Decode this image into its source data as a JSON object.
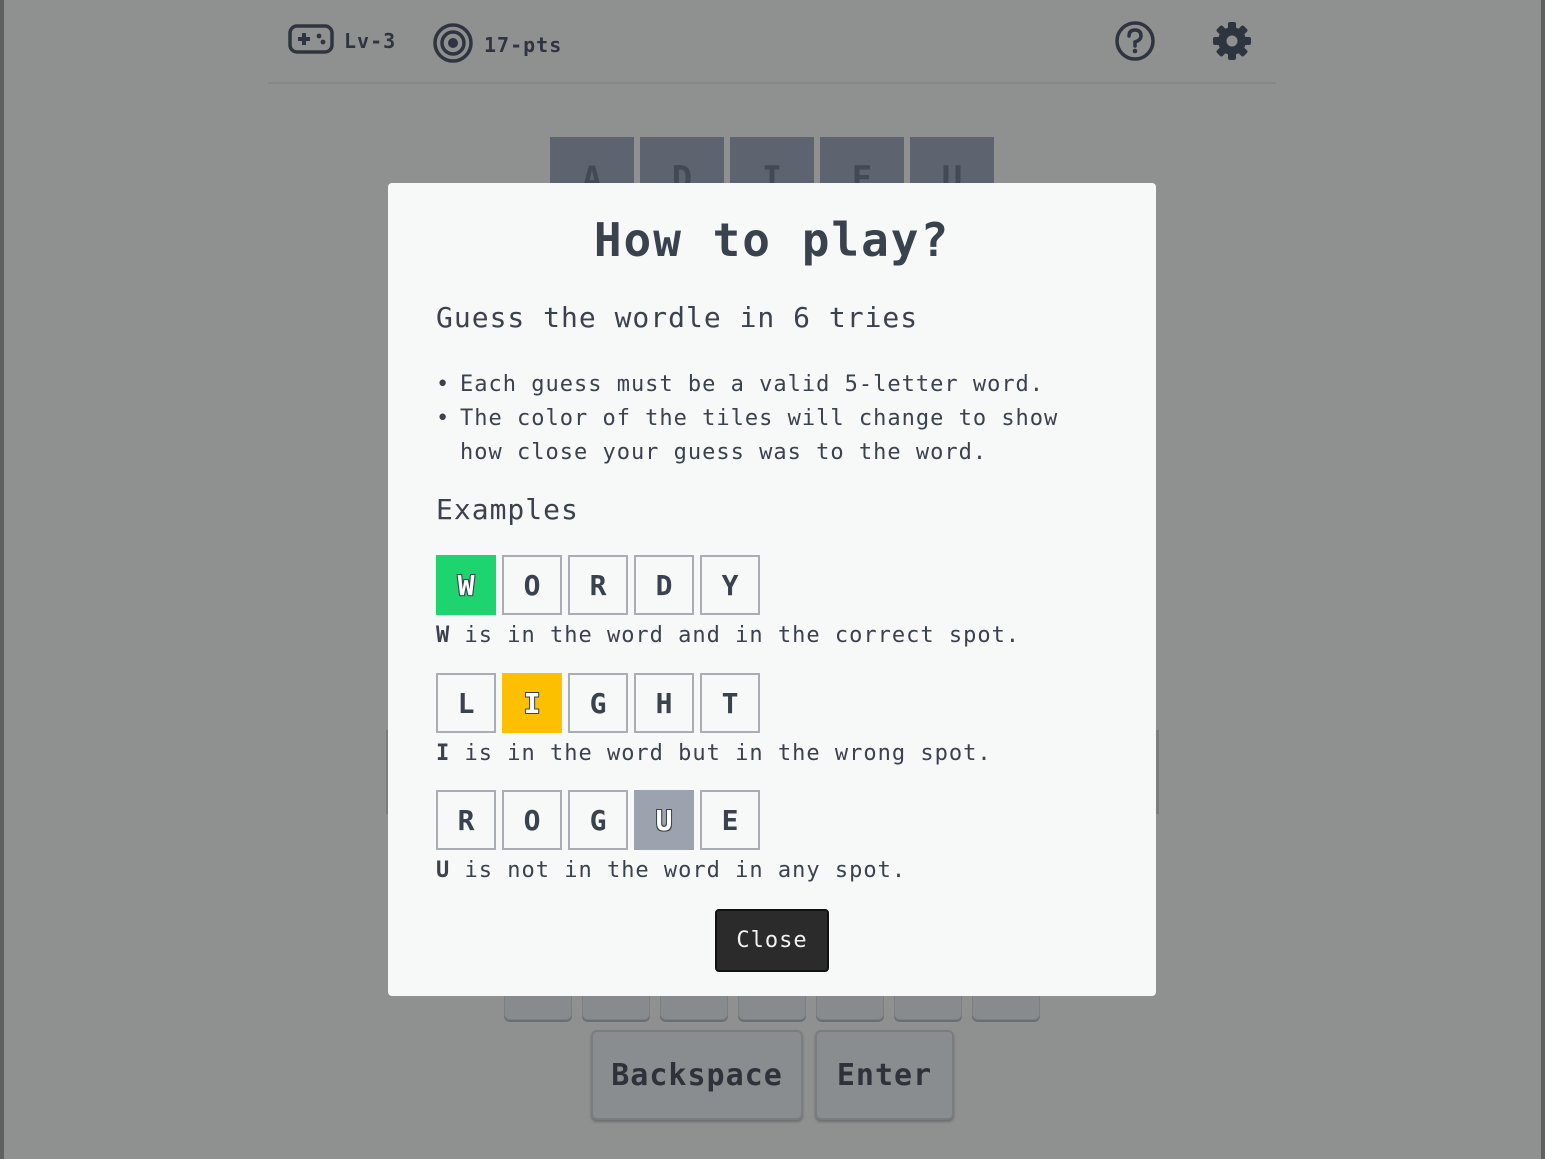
{
  "header": {
    "level_label": "Lv-3",
    "level_icon": "gamepad-icon",
    "points_label": "17-pts",
    "points_icon": "target-icon",
    "help_icon": "question-circle-icon",
    "settings_icon": "gear-icon"
  },
  "board": {
    "first_row": [
      "A",
      "D",
      "I",
      "E",
      "U"
    ]
  },
  "keyboard": {
    "backspace_label": "Backspace",
    "enter_label": "Enter"
  },
  "modal": {
    "title": "How to play?",
    "subtitle": "Guess the wordle in 6 tries",
    "rules": [
      "Each guess must be a valid 5-letter word.",
      "The color of the tiles will change to show how close your guess was to the word."
    ],
    "examples_heading": "Examples",
    "examples": [
      {
        "letters": [
          "W",
          "O",
          "R",
          "D",
          "Y"
        ],
        "highlight_index": 0,
        "status": "correct",
        "letter": "W",
        "description": " is in the word and in the correct spot."
      },
      {
        "letters": [
          "L",
          "I",
          "G",
          "H",
          "T"
        ],
        "highlight_index": 1,
        "status": "present",
        "letter": "I",
        "description": " is in the word but in the wrong spot."
      },
      {
        "letters": [
          "R",
          "O",
          "G",
          "U",
          "E"
        ],
        "highlight_index": 3,
        "status": "absent",
        "letter": "U",
        "description": " is not in the word in any spot."
      }
    ],
    "close_label": "Close"
  },
  "colors": {
    "correct": "#1ed46f",
    "present": "#fdc000",
    "absent": "#9ca3af",
    "overlay": "#8f9190"
  }
}
